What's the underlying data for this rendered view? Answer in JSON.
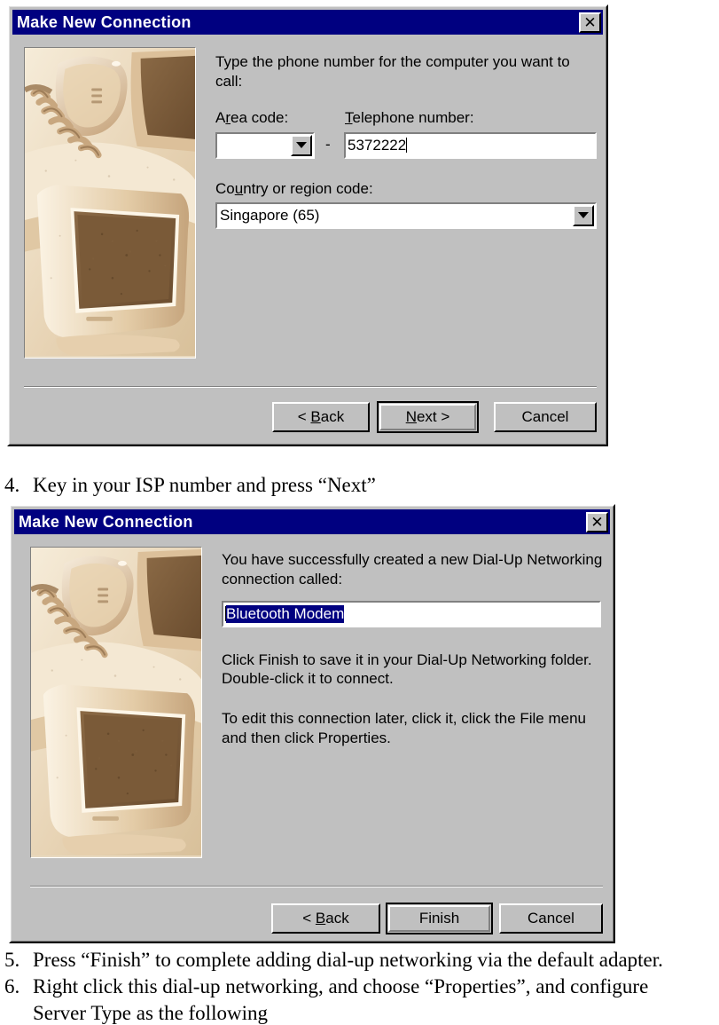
{
  "document": {
    "steps": [
      {
        "num": "4.",
        "text": "Key in your ISP number and press “Next”"
      },
      {
        "num": "5.",
        "text": "Press “Finish” to complete adding dial-up networking via the default adapter."
      },
      {
        "num": "6.",
        "text": "Right click this dial-up networking, and choose “Properties”, and configure",
        "text2": "Server Type as the following"
      }
    ]
  },
  "dialog1": {
    "title": "Make New Connection",
    "close_label": "✕",
    "prompt": "Type the phone number for the computer you want to call:",
    "area_code_label": "Area code:",
    "area_code_value": "",
    "dash": "-",
    "telephone_label": "Telephone number:",
    "telephone_value": "5372222",
    "country_label": "Country or region code:",
    "country_value": "Singapore (65)",
    "buttons": {
      "back": "< Back",
      "next": "Next >",
      "cancel": "Cancel"
    }
  },
  "dialog2": {
    "title": "Make New Connection",
    "close_label": "✕",
    "success_line1": "You have successfully created a new Dial-Up Networking",
    "success_line2": "connection called:",
    "connection_name": "Bluetooth Modem",
    "para1_line1": "Click Finish to save it in your Dial-Up Networking folder.",
    "para1_line2": "Double-click it to connect.",
    "para2_line1": "To edit this connection later, click it, click the File menu",
    "para2_line2": "and then click Properties.",
    "buttons": {
      "back": "< Back",
      "finish": "Finish",
      "cancel": "Cancel"
    }
  },
  "illustration": {
    "name": "telephone-and-monitor-photo",
    "alt": "Sepia photo of a telephone handset and a CRT computer monitor",
    "tone_light": "#f2e6cf",
    "tone_mid": "#c9ab86",
    "tone_dark": "#8a6b46",
    "tone_deep": "#6b4f30"
  },
  "theme": {
    "face": "#c0c0c0",
    "titlebar": "#000080",
    "titlebar_text": "#ffffff",
    "field_bg": "#ffffff",
    "text": "#000000",
    "selection": "#000080"
  }
}
